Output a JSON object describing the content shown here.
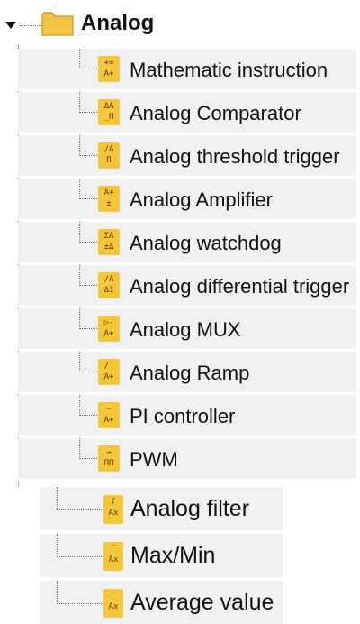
{
  "tree": {
    "root": {
      "label": "Analog",
      "icon": "folder-icon",
      "expanded": true
    },
    "items": [
      {
        "label": "Mathematic instruction",
        "icon": "math-instruction-icon",
        "glyph": [
          "+=",
          "A+"
        ]
      },
      {
        "label": "Analog Comparator",
        "icon": "analog-comparator-icon",
        "glyph": [
          "ΔA",
          "_Π"
        ]
      },
      {
        "label": "Analog threshold trigger",
        "icon": "threshold-trigger-icon",
        "glyph": [
          "/A",
          "Π"
        ]
      },
      {
        "label": "Analog Amplifier",
        "icon": "analog-amplifier-icon",
        "glyph": [
          "A+",
          "±"
        ]
      },
      {
        "label": "Analog watchdog",
        "icon": "analog-watchdog-icon",
        "glyph": [
          "ΣA",
          "±Δ"
        ]
      },
      {
        "label": "Analog differential trigger",
        "icon": "differential-trigger-icon",
        "glyph": [
          "/A",
          "Δ1"
        ]
      },
      {
        "label": "Analog MUX",
        "icon": "analog-mux-icon",
        "glyph": [
          "▷-",
          "A+"
        ]
      },
      {
        "label": "Analog Ramp",
        "icon": "analog-ramp-icon",
        "glyph": [
          "/‾",
          "A+"
        ]
      },
      {
        "label": "PI controller",
        "icon": "pi-controller-icon",
        "glyph": [
          "~",
          "A+"
        ]
      },
      {
        "label": "PWM",
        "icon": "pwm-icon",
        "glyph": [
          "→",
          "ΠΠ"
        ]
      },
      {
        "label": "Analog filter",
        "icon": "analog-filter-icon",
        "glyph": [
          "f",
          "Ax"
        ]
      },
      {
        "label": "Max/Min",
        "icon": "max-min-icon",
        "glyph": [
          "‾",
          "Ax"
        ]
      },
      {
        "label": "Average value",
        "icon": "average-value-icon",
        "glyph": [
          "‾",
          "Ax"
        ]
      }
    ]
  },
  "colors": {
    "icon_background": "#f6c63a",
    "folder": "#f4c542",
    "row_background": "#f1f1f1"
  }
}
